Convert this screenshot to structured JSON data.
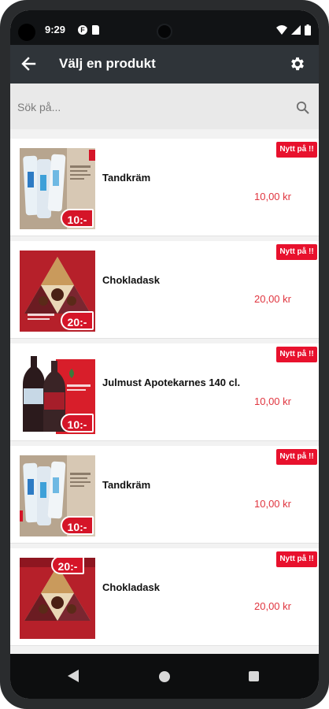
{
  "status_bar": {
    "time": "9:29",
    "icons": [
      "f-notification-icon",
      "sd-card-icon",
      "wifi-icon",
      "signal-icon",
      "battery-icon"
    ]
  },
  "app_bar": {
    "title": "Välj en produkt",
    "back_icon": "arrow-left-icon",
    "settings_icon": "gear-icon"
  },
  "search": {
    "placeholder": "Sök på...",
    "icon": "search-icon"
  },
  "colors": {
    "app_bar": "#2f3439",
    "status_bar": "#111315",
    "badge": "#e8112d",
    "price": "#e0353f"
  },
  "products": [
    {
      "name": "Tandkräm",
      "price": "10,00 kr",
      "badge": "Nytt på !!",
      "sticker": "10:-"
    },
    {
      "name": "Chokladask",
      "price": "20,00 kr",
      "badge": "Nytt på !!",
      "sticker": "20:-"
    },
    {
      "name": "Julmust Apotekarnes 140 cl.",
      "price": "10,00 kr",
      "badge": "Nytt på !!",
      "sticker": "10:-"
    },
    {
      "name": "Tandkräm",
      "price": "10,00 kr",
      "badge": "Nytt på !!",
      "sticker": "10:-"
    },
    {
      "name": "Chokladask",
      "price": "20,00 kr",
      "badge": "Nytt på !!",
      "sticker": "20:-"
    }
  ],
  "nav_bar": {
    "back": "triangle-back-icon",
    "home": "circle-home-icon",
    "recents": "square-recents-icon"
  }
}
